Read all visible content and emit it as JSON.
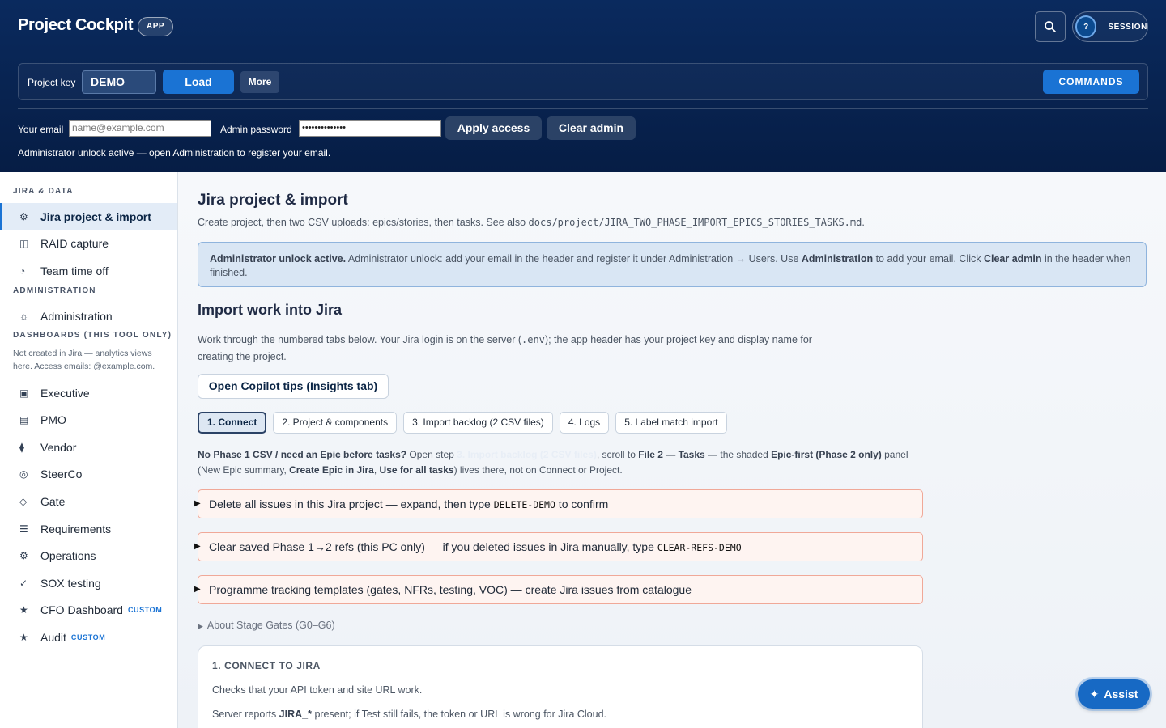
{
  "header": {
    "brand": "Project Cockpit",
    "app_badge": "APP",
    "session_avatar": "?",
    "session_label": "SESSION",
    "project_key_label": "Project key",
    "project_key_value": "DEMO",
    "load_label": "Load",
    "more_label": "More",
    "commands_label": "COMMANDS",
    "email_label": "Your email",
    "email_placeholder": "name@example.com",
    "password_label": "Admin password",
    "password_value": "••••••••••••••",
    "apply_label": "Apply access",
    "clear_label": "Clear admin",
    "admin_note": "Administrator unlock active — open Administration to register your email."
  },
  "sidebar": {
    "section_jira": "JIRA & DATA",
    "section_admin": "ADMINISTRATION",
    "section_dash": "DASHBOARDS (THIS TOOL ONLY)",
    "dash_note": "Not created in Jira — analytics views here. Access emails: @example.com.",
    "custom_tag": "CUSTOM",
    "items": [
      {
        "label": "Jira project & import",
        "icon": "gear-icon",
        "glyph": "⚙"
      },
      {
        "label": "RAID capture",
        "icon": "grid-icon",
        "glyph": "◫"
      },
      {
        "label": "Team time off",
        "icon": "clock-icon",
        "glyph": "◔"
      },
      {
        "label": "Administration",
        "icon": "cog-icon",
        "glyph": "☼"
      },
      {
        "label": "Executive",
        "icon": "square-icon",
        "glyph": "▣"
      },
      {
        "label": "PMO",
        "icon": "list-icon",
        "glyph": "▤"
      },
      {
        "label": "Vendor",
        "icon": "diamond-icon",
        "glyph": "⧫"
      },
      {
        "label": "SteerCo",
        "icon": "target-icon",
        "glyph": "◎"
      },
      {
        "label": "Gate",
        "icon": "diamond-outline-icon",
        "glyph": "◇"
      },
      {
        "label": "Requirements",
        "icon": "menu-icon",
        "glyph": "☰"
      },
      {
        "label": "Operations",
        "icon": "gear-icon",
        "glyph": "⚙"
      },
      {
        "label": "SOX testing",
        "icon": "check-icon",
        "glyph": "✓"
      },
      {
        "label": "CFO Dashboard",
        "icon": "star-icon",
        "glyph": "★"
      },
      {
        "label": "Audit",
        "icon": "star-icon",
        "glyph": "★"
      }
    ]
  },
  "main": {
    "title": "Jira project & import",
    "subtitle_prefix": "Create project, then two CSV uploads: epics/stories, then tasks. See also ",
    "subtitle_code": "docs/project/JIRA_TWO_PHASE_IMPORT_EPICS_STORIES_TASKS.md",
    "subtitle_suffix": ".",
    "info": {
      "bold1": "Administrator unlock active.",
      "text1": " Administrator unlock: add your email in the header and register it under Administration → Users. Use ",
      "bold2": "Administration",
      "text2": " to add your email. Click ",
      "bold3": "Clear admin",
      "text3": " in the header when finished."
    },
    "section_title": "Import work into Jira",
    "para_prefix": "Work through the numbered tabs below. Your Jira login is on the server (",
    "para_code": ".env",
    "para_suffix": "); the app header has your project key and display name for creating the project.",
    "copilot_label": "Open Copilot tips (Insights tab)",
    "tabs": [
      "1. Connect",
      "2. Project & components",
      "3. Import backlog (2 CSV files)",
      "4. Logs",
      "5. Label match import"
    ],
    "hint": {
      "b1": "No Phase 1 CSV / need an Epic before tasks?",
      "t1": " Open step ",
      "faint": "3. Import backlog (2 CSV files)",
      "t2": ", scroll to ",
      "b2": "File 2 — Tasks",
      "t3": " — the shaded ",
      "b3": "Epic-first (Phase 2 only)",
      "t4": " panel (New Epic summary, ",
      "b4": "Create Epic in Jira",
      "t5": ", ",
      "b5": "Use for all tasks",
      "t6": ") lives there, not on Connect or Project."
    },
    "danger1_text": "Delete all issues in this Jira project — expand, then type ",
    "danger1_code": "DELETE-DEMO",
    "danger1_suffix": " to confirm",
    "danger2_text": "Clear saved Phase 1→2 refs (this PC only) — if you deleted issues in Jira manually, type ",
    "danger2_code": "CLEAR-REFS-DEMO",
    "danger3_text": "Programme tracking templates (gates, NFRs, testing, VOC) — create Jira issues from catalogue",
    "stage_label": "About Stage Gates (G0–G6)",
    "card": {
      "title": "1. CONNECT TO JIRA",
      "line1": "Checks that your API token and site URL work.",
      "line2_prefix": "Server reports ",
      "line2_bold": "JIRA_*",
      "line2_suffix": " present; if Test still fails, the token or URL is wrong for Jira Cloud."
    }
  },
  "assist_label": "Assist"
}
